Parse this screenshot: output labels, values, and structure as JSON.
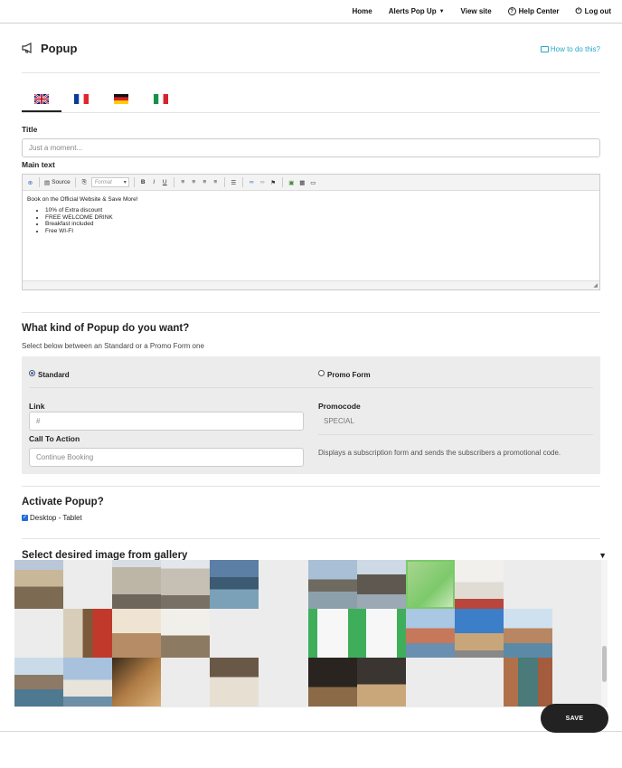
{
  "topnav": {
    "home": "Home",
    "alerts": "Alerts Pop Up",
    "view_site": "View site",
    "help": "Help Center",
    "logout": "Log out"
  },
  "header": {
    "title": "Popup",
    "howto": "How to do this?"
  },
  "languages": [
    {
      "name": "uk-flag-icon",
      "active": true
    },
    {
      "name": "fr-flag-icon",
      "active": false
    },
    {
      "name": "de-flag-icon",
      "active": false
    },
    {
      "name": "it-flag-icon",
      "active": false
    }
  ],
  "form": {
    "title_label": "Title",
    "title_placeholder": "Just a moment...",
    "main_text_label": "Main text"
  },
  "editor": {
    "source_label": "Source",
    "format_label": "Format",
    "heading": "Book on the Official Website & Save More!",
    "bullets": [
      "10% of Extra discount",
      "FREE WELCOME DRINK",
      "Breakfast included",
      "Free WI-FI"
    ]
  },
  "popup_kind": {
    "title": "What kind of Popup do you want?",
    "subtitle": "Select below between an Standard or a Promo Form one",
    "standard_label": "Standard",
    "promo_label": "Promo Form",
    "link_label": "Link",
    "link_placeholder": "#",
    "cta_label": "Call To Action",
    "cta_placeholder": "Continue Booking",
    "promocode_label": "Promocode",
    "promocode_value": "SPECIAL",
    "promo_description": "Displays a subscription form and sends the subscribers a promotional code."
  },
  "activate": {
    "title": "Activate Popup?",
    "desktop_label": "Desktop - Tablet",
    "desktop_checked": true
  },
  "gallery": {
    "title": "Select desired image from gallery",
    "selected_index": 8
  },
  "save_label": "SAVE",
  "colors": {
    "accent": "#1e6fd9",
    "link": "#2aa7c7",
    "save_bg": "#222222",
    "selected": "#7cc96b"
  }
}
